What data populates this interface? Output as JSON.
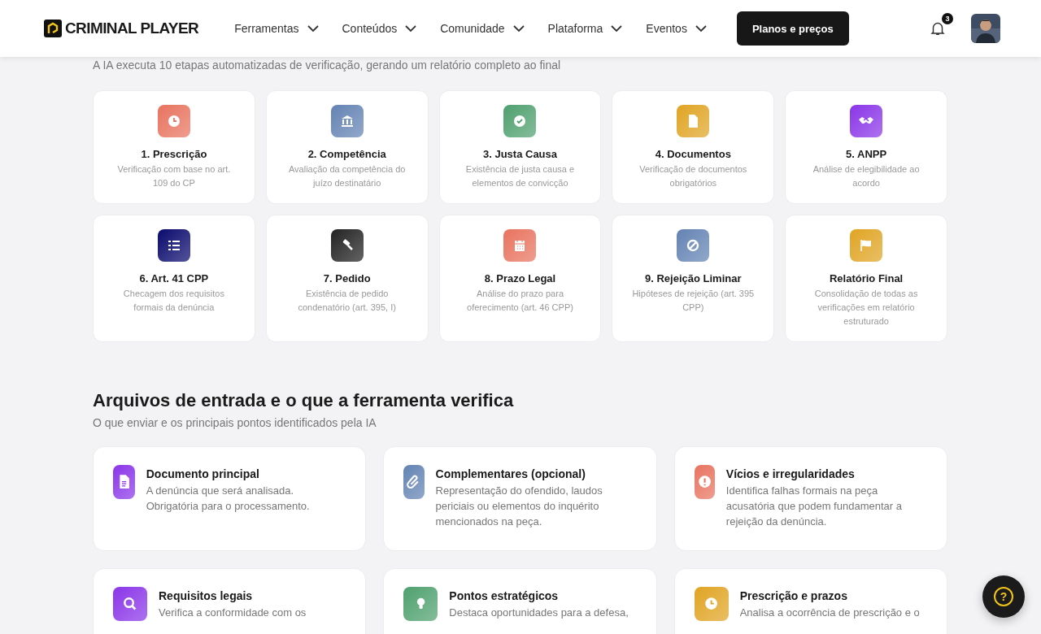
{
  "header": {
    "logo": "CRIMINAL PLAYER",
    "nav": [
      {
        "label": "Ferramentas"
      },
      {
        "label": "Conteúdos"
      },
      {
        "label": "Comunidade"
      },
      {
        "label": "Plataforma"
      },
      {
        "label": "Eventos"
      }
    ],
    "cta": "Planos e preços",
    "notifications": "3"
  },
  "steps_section": {
    "subtitle": "A IA executa 10 etapas automatizadas de verificação, gerando um relatório completo ao final",
    "steps": [
      {
        "title": "1. Prescrição",
        "description": "Verificação com base no art. 109 do CP",
        "color": "#e8735f"
      },
      {
        "title": "2. Competência",
        "description": "Avaliação da competência do juízo destinatário",
        "color": "#6383b3"
      },
      {
        "title": "3. Justa Causa",
        "description": "Existência de justa causa e elementos de convicção",
        "color": "#4fa06f"
      },
      {
        "title": "4. Documentos",
        "description": "Verificação de documentos obrigatórios",
        "color": "#e0a423"
      },
      {
        "title": "5. ANPP",
        "description": "Análise de elegibilidade ao acordo",
        "color": "#8a35e8"
      },
      {
        "title": "6. Art. 41 CPP",
        "description": "Checagem dos requisitos formais da denúncia",
        "color": "#0a0a6e"
      },
      {
        "title": "7. Pedido",
        "description": "Existência de pedido condenatório (art. 395, I)",
        "color": "#222222"
      },
      {
        "title": "8. Prazo Legal",
        "description": "Análise do prazo para oferecimento (art. 46 CPP)",
        "color": "#e8735f"
      },
      {
        "title": "9. Rejeição Liminar",
        "description": "Hipóteses de rejeição (art. 395 CPP)",
        "color": "#6383b3"
      },
      {
        "title": "Relatório Final",
        "description": "Consolidação de todas as verificações em relatório estruturado",
        "color": "#e0a423"
      }
    ]
  },
  "inputs_section": {
    "title": "Arquivos de entrada e o que a ferramenta verifica",
    "subtitle": "O que enviar e os principais pontos identificados pela IA",
    "cards": [
      {
        "title": "Documento principal",
        "description": "A denúncia que será analisada. Obrigatória para o processamento.",
        "color": "#8a35e8"
      },
      {
        "title": "Complementares (opcional)",
        "description": "Representação do ofendido, laudos periciais ou elementos do inquérito mencionados na peça.",
        "color": "#6383b3"
      },
      {
        "title": "Vícios e irregularidades",
        "description": "Identifica falhas formais na peça acusatória que podem fundamentar a rejeição da denúncia.",
        "color": "#e8735f"
      },
      {
        "title": "Requisitos legais",
        "description": "Verifica a conformidade com os",
        "color": "#8a35e8"
      },
      {
        "title": "Pontos estratégicos",
        "description": "Destaca oportunidades para a defesa,",
        "color": "#4fa06f"
      },
      {
        "title": "Prescrição e prazos",
        "description": "Analisa a ocorrência de prescrição e o",
        "color": "#e0a423"
      }
    ]
  },
  "help_button": "?"
}
